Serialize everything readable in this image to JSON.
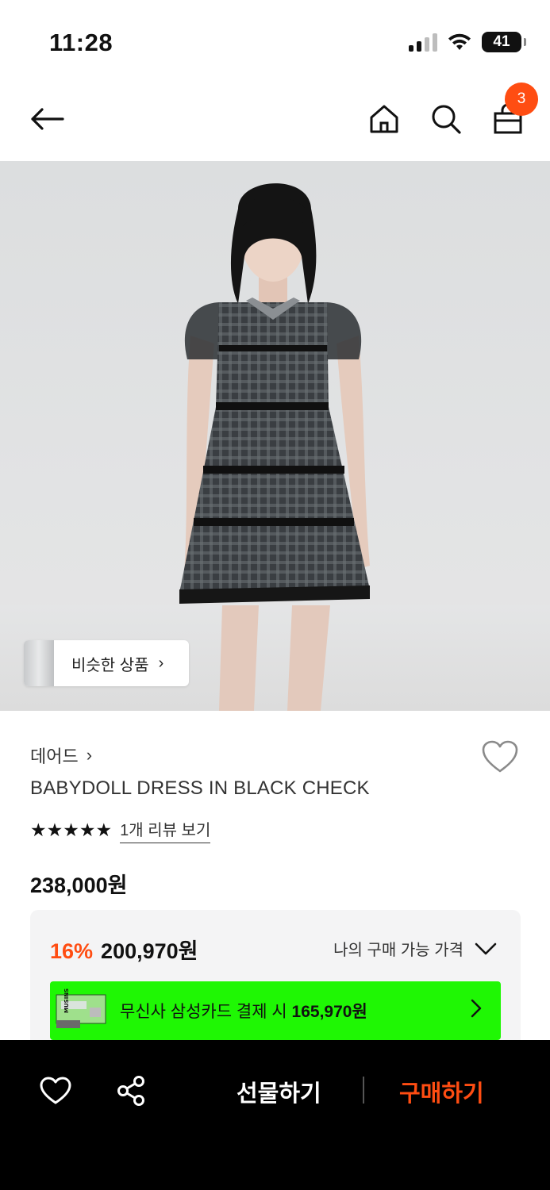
{
  "status_bar": {
    "time": "11:28",
    "battery": "41"
  },
  "header": {
    "cart_badge": "3",
    "icons": [
      "back-arrow-icon",
      "home-icon",
      "search-icon",
      "cart-icon"
    ]
  },
  "hero": {
    "similar_label": "비슷한 상품",
    "similar_chevron": "›"
  },
  "product": {
    "brand": "데어드",
    "brand_chevron": "›",
    "title": "BABYDOLL DRESS IN BLACK CHECK",
    "stars": "★★★★★",
    "review_link": "1개 리뷰 보기",
    "original_price": "238,000원"
  },
  "price_box": {
    "discount_percent": "16%",
    "discount_price": "200,970원",
    "my_price_label": "나의 구매 가능 가격",
    "card_banner_text": "무신사 삼성카드 결제 시",
    "card_banner_price": "165,970원",
    "card_thumb_text": "MUSINSA"
  },
  "bottom_bar": {
    "gift_label": "선물하기",
    "buy_label": "구매하기"
  },
  "colors": {
    "accent": "#ff4d12",
    "banner_green": "#1ff704",
    "bottom_bar": "#000000"
  }
}
